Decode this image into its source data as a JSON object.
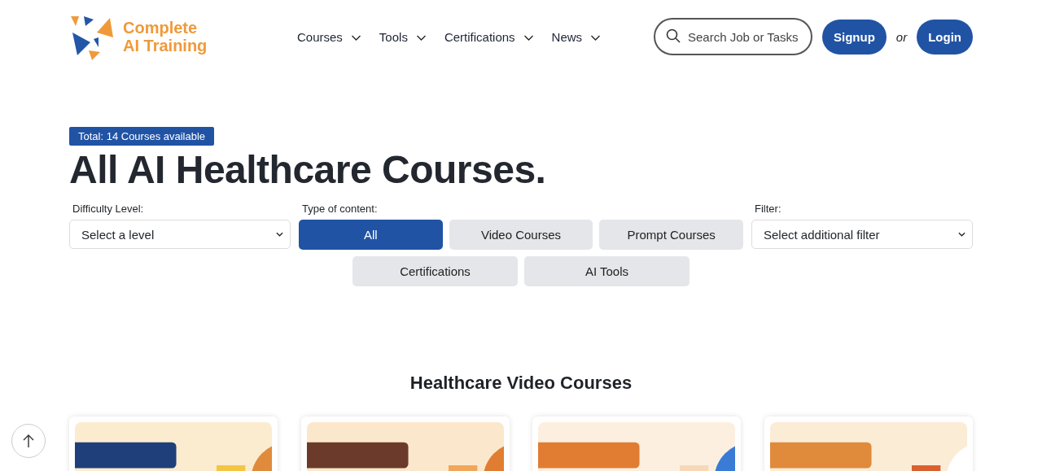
{
  "logo": {
    "line_1": "Complete",
    "line_2": "AI Training"
  },
  "nav": [
    {
      "label": "Courses"
    },
    {
      "label": "Tools"
    },
    {
      "label": "Certifications"
    },
    {
      "label": "News"
    }
  ],
  "search": {
    "placeholder": "Search Job or Tasks"
  },
  "auth": {
    "signup": "Signup",
    "separator": "or",
    "login": "Login"
  },
  "total_badge": "Total: 14 Courses available",
  "title": "All AI Healthcare Courses.",
  "filters": {
    "difficulty": {
      "label": "Difficulty Level:",
      "value": "Select a level"
    },
    "content_type": {
      "label": "Type of content:",
      "options": [
        {
          "label": "All",
          "selected": true
        },
        {
          "label": "Video Courses",
          "selected": false
        },
        {
          "label": "Prompt Courses",
          "selected": false
        },
        {
          "label": "Certifications",
          "selected": false
        },
        {
          "label": "AI Tools",
          "selected": false
        }
      ]
    },
    "filter": {
      "label": "Filter:",
      "value": "Select additional filter"
    }
  },
  "section_title": "Healthcare Video Courses"
}
